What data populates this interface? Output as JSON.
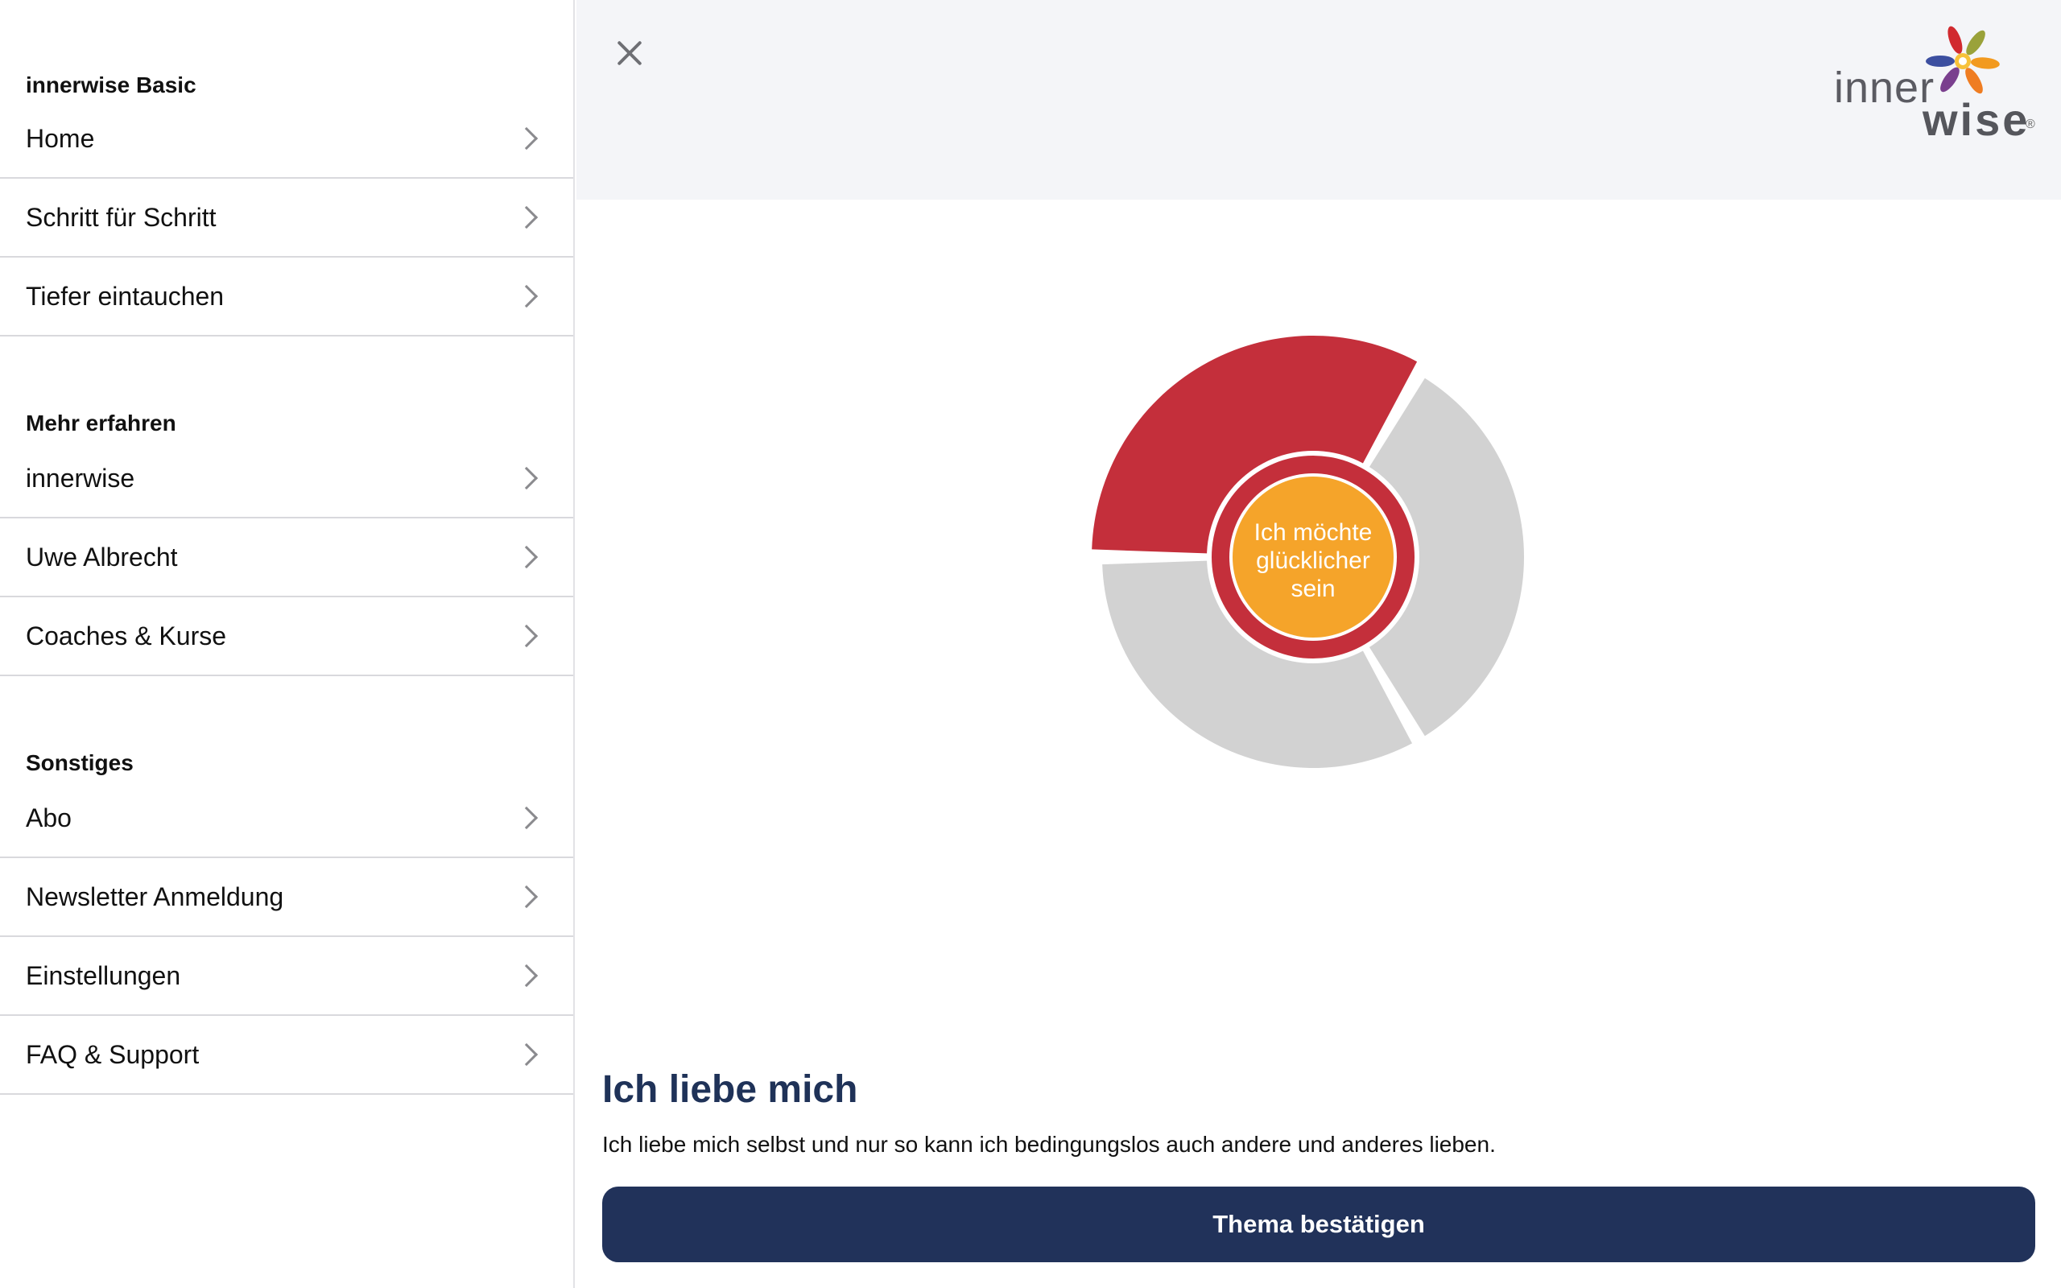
{
  "sidebar": {
    "sections": [
      {
        "title": "innerwise Basic",
        "items": [
          {
            "label": "Home"
          },
          {
            "label": "Schritt für Schritt"
          },
          {
            "label": "Tiefer eintauchen"
          }
        ]
      },
      {
        "title": "Mehr erfahren",
        "items": [
          {
            "label": "innerwise"
          },
          {
            "label": "Uwe Albrecht"
          },
          {
            "label": "Coaches & Kurse"
          }
        ]
      },
      {
        "title": "Sonstiges",
        "items": [
          {
            "label": "Abo"
          },
          {
            "label": "Newsletter Anmeldung"
          },
          {
            "label": "Einstellungen"
          },
          {
            "label": "FAQ & Support"
          }
        ]
      }
    ]
  },
  "header": {
    "logo": {
      "part1": "inner",
      "part2": "wise",
      "registered": "®"
    }
  },
  "wheel": {
    "center_lines": [
      "Ich möchte",
      "glücklicher",
      "sein"
    ],
    "segments": [
      {
        "name": "selected",
        "color": "#c42f3b"
      },
      {
        "name": "segment-right",
        "color": "#d2d2d2"
      },
      {
        "name": "segment-bottom",
        "color": "#d2d2d2"
      }
    ],
    "center_color": "#f5a42a",
    "ring_color": "#c42f3b"
  },
  "topic": {
    "title": "Ich liebe mich",
    "description": "Ich liebe mich selbst und nur so kann ich bedingungslos auch andere und anderes lieben."
  },
  "actions": {
    "confirm_label": "Thema bestätigen"
  },
  "colors": {
    "primary": "#21325a",
    "title": "#1f3258",
    "accent_red": "#c42f3b",
    "accent_orange": "#f5a42a"
  }
}
